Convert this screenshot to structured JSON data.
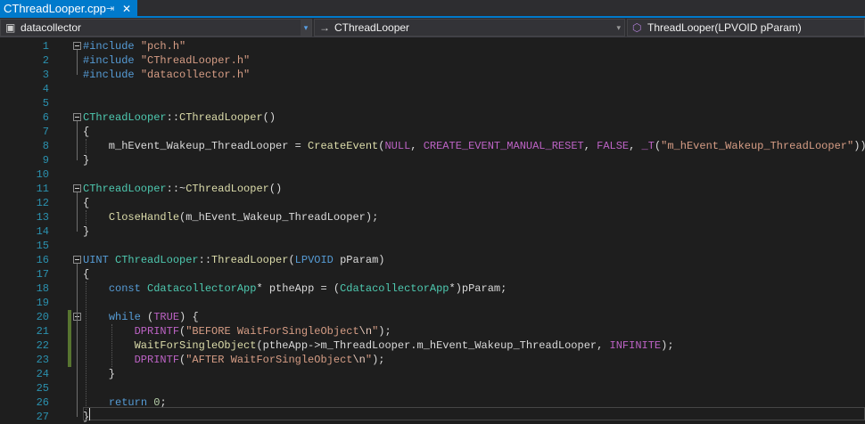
{
  "tab": {
    "title": "CThreadLooper.cpp",
    "pin_icon": "pin-icon",
    "close_icon": "close-icon"
  },
  "navbar": {
    "project": "datacollector",
    "scope": "CThreadLooper",
    "member": "ThreadLooper(LPVOID pParam)"
  },
  "colors": {
    "keyword": "#569cd6",
    "type": "#4ec9b0",
    "function": "#dcdcaa",
    "string": "#d69d85",
    "macro": "#bd63c5",
    "number": "#b5cea8",
    "escape": "#e8c9bb",
    "text": "#dadada",
    "line_number": "#2b91af",
    "change_bar": "#577430",
    "accent": "#007acc"
  },
  "lines": [
    {
      "n": "1",
      "tokens": [
        [
          "kw",
          "#include"
        ],
        [
          "t",
          " "
        ],
        [
          "s",
          "\"pch.h\""
        ]
      ]
    },
    {
      "n": "2",
      "tokens": [
        [
          "kw",
          "#include"
        ],
        [
          "t",
          " "
        ],
        [
          "s",
          "\"CThreadLooper.h\""
        ]
      ]
    },
    {
      "n": "3",
      "tokens": [
        [
          "kw",
          "#include"
        ],
        [
          "t",
          " "
        ],
        [
          "s",
          "\"datacollector.h\""
        ]
      ]
    },
    {
      "n": "4",
      "tokens": []
    },
    {
      "n": "5",
      "tokens": []
    },
    {
      "n": "6",
      "tokens": [
        [
          "ty",
          "CThreadLooper"
        ],
        [
          "t",
          "::"
        ],
        [
          "fn",
          "CThreadLooper"
        ],
        [
          "t",
          "()"
        ]
      ]
    },
    {
      "n": "7",
      "tokens": [
        [
          "t",
          "{"
        ]
      ]
    },
    {
      "n": "8",
      "tokens": [
        [
          "t",
          "    m_hEvent_Wakeup_ThreadLooper = "
        ],
        [
          "fn",
          "CreateEvent"
        ],
        [
          "t",
          "("
        ],
        [
          "mc",
          "NULL"
        ],
        [
          "t",
          ", "
        ],
        [
          "mc",
          "CREATE_EVENT_MANUAL_RESET"
        ],
        [
          "t",
          ", "
        ],
        [
          "mc",
          "FALSE"
        ],
        [
          "t",
          ", "
        ],
        [
          "mc",
          "_T"
        ],
        [
          "t",
          "("
        ],
        [
          "s",
          "\"m_hEvent_Wakeup_ThreadLooper\""
        ],
        [
          "t",
          "));"
        ]
      ]
    },
    {
      "n": "9",
      "tokens": [
        [
          "t",
          "}"
        ]
      ]
    },
    {
      "n": "10",
      "tokens": []
    },
    {
      "n": "11",
      "tokens": [
        [
          "ty",
          "CThreadLooper"
        ],
        [
          "t",
          "::~"
        ],
        [
          "fn",
          "CThreadLooper"
        ],
        [
          "t",
          "()"
        ]
      ]
    },
    {
      "n": "12",
      "tokens": [
        [
          "t",
          "{"
        ]
      ]
    },
    {
      "n": "13",
      "tokens": [
        [
          "t",
          "    "
        ],
        [
          "fn",
          "CloseHandle"
        ],
        [
          "t",
          "(m_hEvent_Wakeup_ThreadLooper);"
        ]
      ]
    },
    {
      "n": "14",
      "tokens": [
        [
          "t",
          "}"
        ]
      ]
    },
    {
      "n": "15",
      "tokens": []
    },
    {
      "n": "16",
      "tokens": [
        [
          "kw",
          "UINT"
        ],
        [
          "t",
          " "
        ],
        [
          "ty",
          "CThreadLooper"
        ],
        [
          "t",
          "::"
        ],
        [
          "fn",
          "ThreadLooper"
        ],
        [
          "t",
          "("
        ],
        [
          "kw",
          "LPVOID"
        ],
        [
          "t",
          " pParam)"
        ]
      ]
    },
    {
      "n": "17",
      "tokens": [
        [
          "t",
          "{"
        ]
      ]
    },
    {
      "n": "18",
      "tokens": [
        [
          "t",
          "    "
        ],
        [
          "kw",
          "const"
        ],
        [
          "t",
          " "
        ],
        [
          "ty",
          "CdatacollectorApp"
        ],
        [
          "t",
          "* ptheApp = ("
        ],
        [
          "ty",
          "CdatacollectorApp"
        ],
        [
          "t",
          "*)pParam;"
        ]
      ]
    },
    {
      "n": "19",
      "tokens": []
    },
    {
      "n": "20",
      "tokens": [
        [
          "t",
          "    "
        ],
        [
          "kw",
          "while"
        ],
        [
          "t",
          " ("
        ],
        [
          "mc",
          "TRUE"
        ],
        [
          "t",
          ") {"
        ]
      ]
    },
    {
      "n": "21",
      "tokens": [
        [
          "t",
          "        "
        ],
        [
          "mc",
          "DPRINTF"
        ],
        [
          "t",
          "("
        ],
        [
          "s",
          "\"BEFORE WaitForSingleObject"
        ],
        [
          "es",
          "\\n"
        ],
        [
          "s",
          "\""
        ],
        [
          "t",
          ");"
        ]
      ]
    },
    {
      "n": "22",
      "tokens": [
        [
          "t",
          "        "
        ],
        [
          "fn",
          "WaitForSingleObject"
        ],
        [
          "t",
          "(ptheApp->m_ThreadLooper.m_hEvent_Wakeup_ThreadLooper, "
        ],
        [
          "mc",
          "INFINITE"
        ],
        [
          "t",
          ");"
        ]
      ]
    },
    {
      "n": "23",
      "tokens": [
        [
          "t",
          "        "
        ],
        [
          "mc",
          "DPRINTF"
        ],
        [
          "t",
          "("
        ],
        [
          "s",
          "\"AFTER WaitForSingleObject"
        ],
        [
          "es",
          "\\n"
        ],
        [
          "s",
          "\""
        ],
        [
          "t",
          ");"
        ]
      ]
    },
    {
      "n": "24",
      "tokens": [
        [
          "t",
          "    }"
        ]
      ]
    },
    {
      "n": "25",
      "tokens": []
    },
    {
      "n": "26",
      "tokens": [
        [
          "t",
          "    "
        ],
        [
          "kw",
          "return"
        ],
        [
          "t",
          " "
        ],
        [
          "nm",
          "0"
        ],
        [
          "t",
          ";"
        ]
      ]
    },
    {
      "n": "27",
      "tokens": [
        [
          "t",
          "}"
        ]
      ]
    }
  ],
  "changed_lines": [
    "20",
    "21",
    "22",
    "23"
  ],
  "fold_lines": [
    "1",
    "6",
    "11",
    "16",
    "20"
  ]
}
